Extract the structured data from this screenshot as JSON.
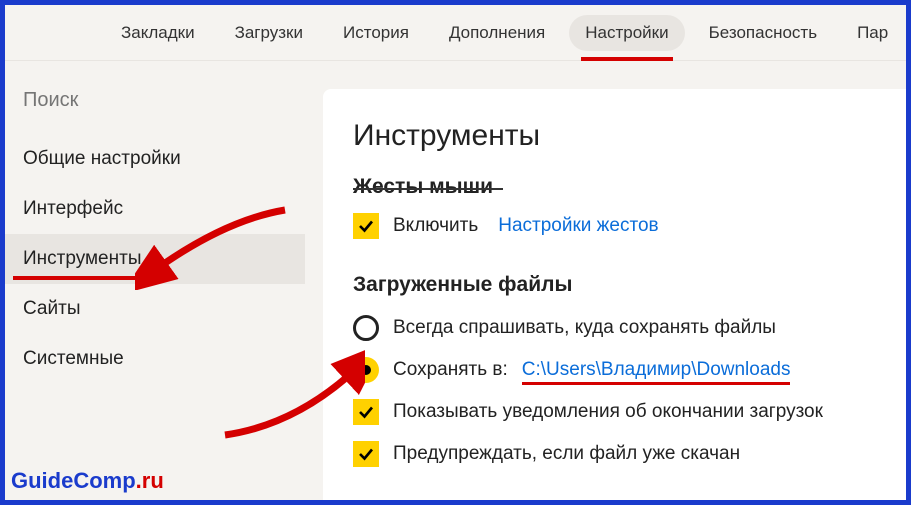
{
  "topTabs": {
    "bookmarks": "Закладки",
    "downloads": "Загрузки",
    "history": "История",
    "addons": "Дополнения",
    "settings": "Настройки",
    "security": "Безопасность",
    "passwords": "Пар"
  },
  "sidebar": {
    "searchPlaceholder": "Поиск",
    "items": {
      "general": "Общие настройки",
      "interface": "Интерфейс",
      "tools": "Инструменты",
      "sites": "Сайты",
      "system": "Системные"
    }
  },
  "main": {
    "heading": "Инструменты",
    "mouseGestures": {
      "title": "Жесты мыши",
      "enable": "Включить",
      "gestureSettings": "Настройки жестов"
    },
    "downloadedFiles": {
      "title": "Загруженные файлы",
      "alwaysAsk": "Всегда спрашивать, куда сохранять файлы",
      "saveTo": "Сохранять в:",
      "path": "C:\\Users\\Владимир\\Downloads",
      "showNotifications": "Показывать уведомления об окончании загрузок",
      "warnDuplicate": "Предупреждать, если файл уже скачан"
    }
  },
  "watermark": {
    "a": "GuideComp",
    "b": ".ru"
  }
}
